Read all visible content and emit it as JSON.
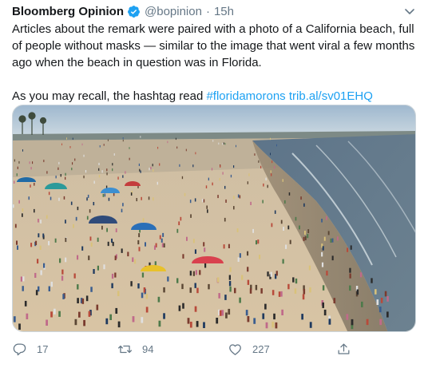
{
  "tweet": {
    "author_name": "Bloomberg Opinion",
    "handle": "@bopinion",
    "separator": "·",
    "time": "15h",
    "paragraph1": "Articles about the remark were paired with a photo of a California beach, full of people without masks — similar to the image that went viral a few months ago when the beach in question was in Florida.",
    "paragraph2_prefix": "As you may recall, the hashtag read ",
    "hashtag": "#floridamorons",
    "link": "trib.al/sv01EHQ"
  },
  "actions": {
    "reply_count": "17",
    "retweet_count": "94",
    "like_count": "227"
  },
  "icons": {
    "verified": "verified-badge-icon",
    "more": "chevron-down-icon",
    "reply": "reply-icon",
    "retweet": "retweet-icon",
    "like": "heart-icon",
    "share": "share-icon"
  },
  "colors": {
    "accent": "#1da1f2",
    "secondary_text": "#657786",
    "primary_text": "#14171a"
  }
}
